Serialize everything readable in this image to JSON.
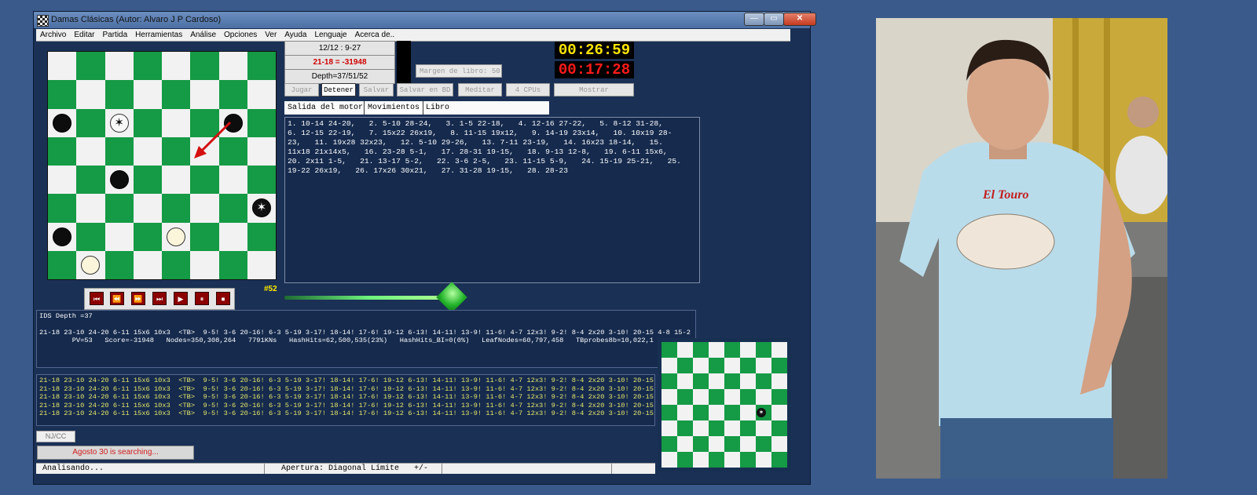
{
  "window": {
    "title": "Damas Clásicas  (Autor: Alvaro J P Cardoso)",
    "min_glyph": "—",
    "max_glyph": "▭",
    "close_glyph": "✕"
  },
  "menu": [
    "Archivo",
    "Editar",
    "Partida",
    "Herramientas",
    "Análise",
    "Opciones",
    "Ver",
    "Ayuda",
    "Lenguaje",
    "Acerca de.."
  ],
  "info": {
    "date_line": "12/12 : 9-27",
    "eval_line": "21-18 = -31948",
    "depth_line": "Depth=37/51/52",
    "book_margin": "Margen de libro: 50"
  },
  "clocks": {
    "white": "00:26:59",
    "black": "00:17:28"
  },
  "toolbar": [
    "Jugar",
    "Detener",
    "Salvar",
    "Salvar en BD",
    "Meditar",
    "4 CPUs",
    "Mostrar"
  ],
  "tabs": [
    "Salida del motor",
    "Movimientos",
    "Libro"
  ],
  "moves_text": "1. 10-14 24-20,   2. 5-10 28-24,   3. 1-5 22-18,   4. 12-16 27-22,   5. 8-12 31-28,\n6. 12-15 22-19,   7. 15x22 26x19,   8. 11-15 19x12,   9. 14-19 23x14,   10. 10x19 28-\n23,   11. 19x28 32x23,   12. 5-10 29-26,   13. 7-11 23-19,   14. 16x23 18-14,   15.\n11x18 21x14x5,   16. 23-28 5-1,   17. 28-31 19-15,   18. 9-13 12-8,   19. 6-11 15x6,\n20. 2x11 1-5,   21. 13-17 5-2,   22. 3-6 2-5,   23. 11-15 5-9,   24. 15-19 25-21,   25.\n19-22 26x19,   26. 17x26 30x21,   27. 31-28 19-15,   28. 28-23",
  "move_number": "#52",
  "controls": [
    "⏮",
    "⏪",
    "⏩",
    "⏭",
    "▶",
    "⏸",
    "⏹"
  ],
  "engine": {
    "ids_depth": "IDS Depth =37",
    "pv_line": "21-18 23-10 24-20 6-11 15x6 10x3  <TB>  9-5! 3-6 20-16! 6-3 5-19 3-17! 18-14! 17-6! 19-12 6-13! 14-11! 13-9! 11-6! 4-7 12x3! 9-2! 8-4 2x20 3-10! 20-15 4-8 15-2",
    "stats_line": "        PV=53   Score=-31948   Nodes=350,308,264   7791KNs   HashHits=62,500,535(23%)   HashHits_BI=0(0%)   LeafNodes=60,797,458   TBprobes8b=10,022,1"
  },
  "log_lines": [
    "21-18 23-10 24-20 6-11 15x6 10x3  <TB>  9-5! 3-6 20-16! 6-3 5-19 3-17! 18-14! 17-6! 19-12 6-13! 14-11! 13-9! 11-6! 4-7 12x3! 9-2! 8-4 2x20 3-10! 20-15",
    "21-18 23-10 24-20 6-11 15x6 10x3  <TB>  9-5! 3-6 20-16! 6-3 5-19 3-17! 18-14! 17-6! 19-12 6-13! 14-11! 13-9! 11-6! 4-7 12x3! 9-2! 8-4 2x20 3-10! 20-15",
    "21-18 23-10 24-20 6-11 15x6 10x3  <TB>  9-5! 3-6 20-16! 6-3 5-19 3-17! 18-14! 17-6! 19-12 6-13! 14-11! 13-9! 11-6! 4-7 12x3! 9-2! 8-4 2x20 3-10! 20-15",
    "21-18 23-10 24-20 6-11 15x6 10x3  <TB>  9-5! 3-6 20-16! 6-3 5-19 3-17! 18-14! 17-6! 19-12 6-13! 14-11! 13-9! 11-6! 4-7 12x3! 9-2! 8-4 2x20 3-10! 20-15",
    "21-18 23-10 24-20 6-11 15x6 10x3  <TB>  9-5! 3-6 20-16! 6-3 5-19 3-17! 18-14! 17-6! 19-12 6-13! 14-11! 13-9! 11-6! 4-7 12x3! 9-2! 8-4 2x20 3-10! 20-15"
  ],
  "njcc": "NJ/CC",
  "searching": "Agosto 30 is searching...",
  "status": {
    "left": "Analisando...",
    "opening": "Apertura: Diagonal Límite",
    "eval": "+/-"
  },
  "photo": {
    "shirt_text": "El Touro"
  },
  "board": {
    "pieces": [
      {
        "type": "black",
        "row": 2,
        "col": 0
      },
      {
        "type": "wking",
        "row": 2,
        "col": 2
      },
      {
        "type": "black",
        "row": 2,
        "col": 6
      },
      {
        "type": "black",
        "row": 4,
        "col": 2
      },
      {
        "type": "bking",
        "row": 5,
        "col": 7
      },
      {
        "type": "black",
        "row": 6,
        "col": 0
      },
      {
        "type": "white",
        "row": 6,
        "col": 4
      },
      {
        "type": "white",
        "row": 7,
        "col": 1
      }
    ]
  },
  "colors": {
    "board_dark": "#159a45",
    "board_light": "#f2f2f2",
    "clock_white": "#ffe500",
    "clock_black": "#ff1a1a",
    "log_text": "#e5e66a"
  }
}
